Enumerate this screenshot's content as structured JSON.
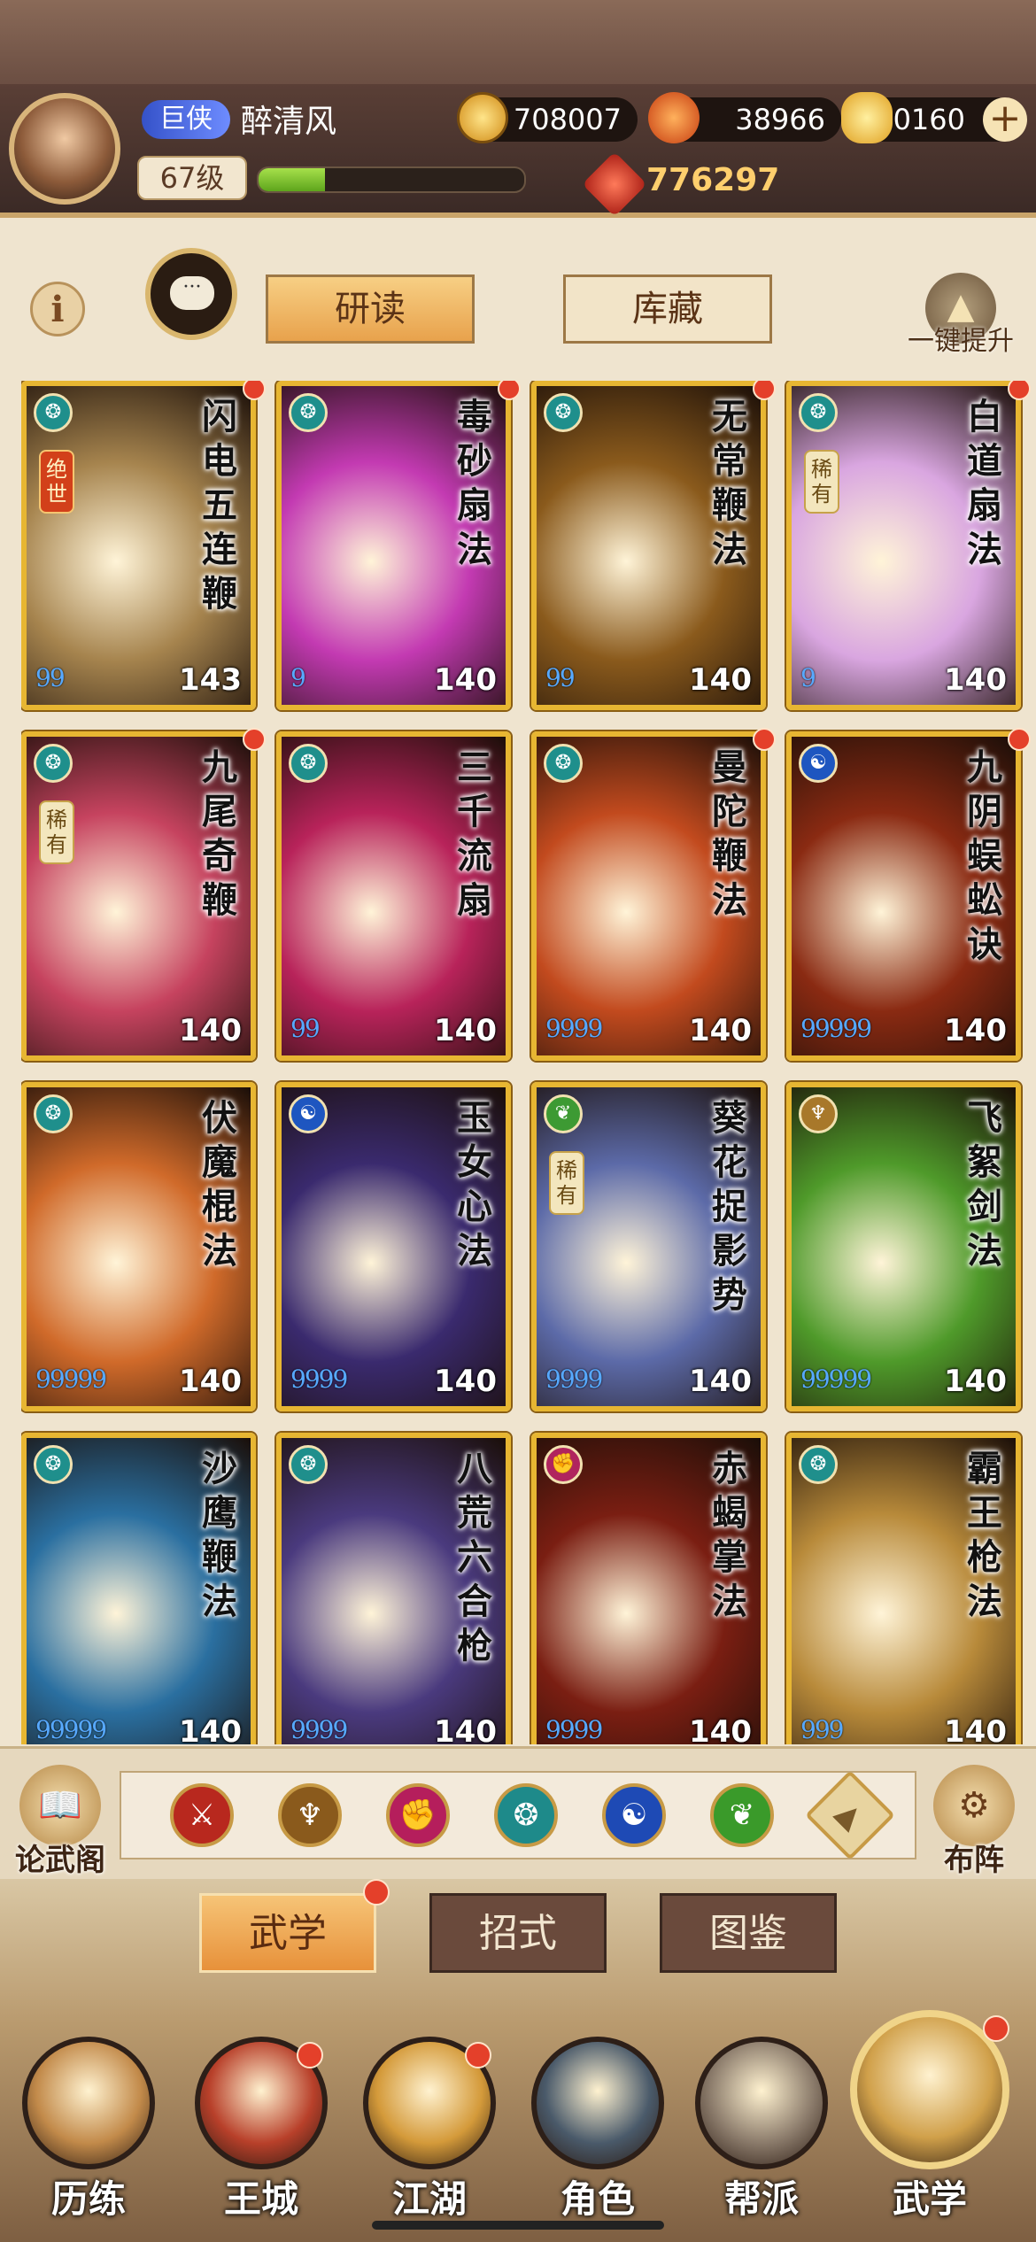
{
  "player": {
    "rank": "巨侠",
    "name": "醉清风",
    "level": "67级",
    "xp_progress": 0.25,
    "coins": "708007",
    "leaves": "38966",
    "ingots": "30160",
    "power": "776297"
  },
  "top_tabs": {
    "yandu": "研读",
    "kucang": "库藏"
  },
  "upgrade_label": "一键提升",
  "cards": [
    {
      "name": "闪电五连鞭",
      "level": "143",
      "badge": "绝世",
      "dots": "99",
      "element": "teal",
      "alert": true,
      "art": "#a6844e"
    },
    {
      "name": "毒砂扇法",
      "level": "140",
      "badge": "",
      "dots": "9",
      "element": "teal",
      "alert": true,
      "art": "#c33ab2"
    },
    {
      "name": "无常鞭法",
      "level": "140",
      "badge": "",
      "dots": "99",
      "element": "teal",
      "alert": true,
      "art": "#8a5a1c"
    },
    {
      "name": "白道扇法",
      "level": "140",
      "badge": "稀有",
      "dots": "9",
      "element": "teal",
      "alert": true,
      "art": "#d9a6e0"
    },
    {
      "name": "九尾奇鞭",
      "level": "140",
      "badge": "稀有",
      "dots": "",
      "element": "teal",
      "alert": true,
      "art": "#c6435f"
    },
    {
      "name": "三千流扇",
      "level": "140",
      "badge": "",
      "dots": "99",
      "element": "teal",
      "alert": false,
      "art": "#b8235a"
    },
    {
      "name": "曼陀鞭法",
      "level": "140",
      "badge": "",
      "dots": "9999",
      "element": "teal",
      "alert": true,
      "art": "#c24a1e"
    },
    {
      "name": "九阴蜈蚣诀",
      "level": "140",
      "badge": "",
      "dots": "99999",
      "element": "blue",
      "alert": true,
      "art": "#8a2a12"
    },
    {
      "name": "伏魔棍法",
      "level": "140",
      "badge": "",
      "dots": "99999",
      "element": "teal",
      "alert": false,
      "art": "#d06a2a"
    },
    {
      "name": "玉女心法",
      "level": "140",
      "badge": "",
      "dots": "9999",
      "element": "blue",
      "alert": false,
      "art": "#3a2a6e"
    },
    {
      "name": "葵花捉影势",
      "level": "140",
      "badge": "稀有",
      "dots": "9999",
      "element": "green",
      "alert": false,
      "art": "#5c6aa8"
    },
    {
      "name": "飞絮剑法",
      "level": "140",
      "badge": "",
      "dots": "99999",
      "element": "gold",
      "alert": false,
      "art": "#4f9a2a"
    },
    {
      "name": "沙鹰鞭法",
      "level": "140",
      "badge": "",
      "dots": "99999",
      "element": "teal",
      "alert": false,
      "art": "#2a6fa0"
    },
    {
      "name": "八荒六合枪",
      "level": "140",
      "badge": "",
      "dots": "9999",
      "element": "teal",
      "alert": false,
      "art": "#4a3a7e"
    },
    {
      "name": "赤蝎掌法",
      "level": "140",
      "badge": "",
      "dots": "9999",
      "element": "pink",
      "alert": false,
      "art": "#7a1e12"
    },
    {
      "name": "霸王枪法",
      "level": "140",
      "badge": "",
      "dots": "999",
      "element": "teal",
      "alert": false,
      "art": "#b88a3a"
    }
  ],
  "filter_icons": [
    {
      "name": "blade-filter-icon",
      "color": "#b8281e",
      "glyph": "⚔"
    },
    {
      "name": "sword-filter-icon",
      "color": "#8a5a1c",
      "glyph": "♆"
    },
    {
      "name": "fist-filter-icon",
      "color": "#b51e5c",
      "glyph": "✊"
    },
    {
      "name": "fan-filter-icon",
      "color": "#1e8a8a",
      "glyph": "❂"
    },
    {
      "name": "taiji-filter-icon",
      "color": "#1e4ab5",
      "glyph": "☯"
    },
    {
      "name": "leaf-filter-icon",
      "color": "#3a9a2a",
      "glyph": "❦"
    },
    {
      "name": "more-filter-icon",
      "color": "#e8d4a0",
      "glyph": "▲"
    }
  ],
  "side_buttons": {
    "left": "论武阁",
    "right": "布阵"
  },
  "sub_tabs": [
    "武学",
    "招式",
    "图鉴"
  ],
  "nav": [
    {
      "label": "历练",
      "alert": false,
      "color": "#c28a4a"
    },
    {
      "label": "王城",
      "alert": true,
      "color": "#b8402a"
    },
    {
      "label": "江湖",
      "alert": true,
      "color": "#d49a3a"
    },
    {
      "label": "角色",
      "alert": false,
      "color": "#4a5a6a"
    },
    {
      "label": "帮派",
      "alert": false,
      "color": "#8a7a6a"
    },
    {
      "label": "武学",
      "alert": true,
      "color": "#d0a04a"
    }
  ]
}
